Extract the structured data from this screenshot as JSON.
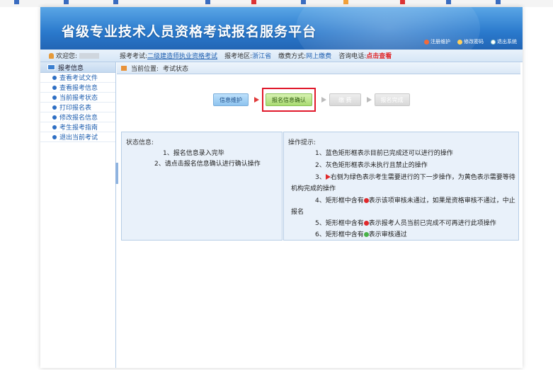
{
  "platform": {
    "title": "省级专业技术人员资格考试报名服务平台"
  },
  "toplinks": [
    {
      "label": "注册维护",
      "icon": "home-icon"
    },
    {
      "label": "修改密码",
      "icon": "lock-icon"
    },
    {
      "label": "退出系统",
      "icon": "power-icon"
    }
  ],
  "infobar": {
    "welcome": "欢迎您:",
    "exam_label": "报考考试:",
    "exam_value": "二级建造师执业资格考试",
    "region_label": "报考地区:",
    "region_value": "浙江省",
    "pay_label": "缴费方式:",
    "pay_value": "网上缴费",
    "phone_label": "咨询电话:",
    "phone_value": "点击查看"
  },
  "sidebar": {
    "header": "报考信息",
    "items": [
      {
        "label": "查看考试文件"
      },
      {
        "label": "查看报考信息"
      },
      {
        "label": "当前报考状态"
      },
      {
        "label": "打印报名表"
      },
      {
        "label": "修改报名信息"
      },
      {
        "label": "考生报考指南"
      },
      {
        "label": "退出当前考试"
      }
    ]
  },
  "breadcrumb": {
    "label": "当前位置:",
    "value": "考试状态"
  },
  "steps": [
    {
      "label": "信息维护",
      "state": "blue"
    },
    {
      "label": "报名信息确认",
      "state": "green"
    },
    {
      "label": "缴 费",
      "state": "gray"
    },
    {
      "label": "报名完成",
      "state": "gray"
    }
  ],
  "status_panel": {
    "title": "状态信息:",
    "lines": [
      "1、报名信息录入完毕",
      "2、请点击报名信息确认进行确认操作"
    ]
  },
  "hint_panel": {
    "title": "操作提示:",
    "line1": "1、蓝色矩形框表示目前已完成还可以进行的操作",
    "line2": "2、灰色矩形框表示未执行且禁止的操作",
    "line3_pre": "3、",
    "line3_post": "右侧为绿色表示考生需要进行的下一步操作，为黄色表示需要等待",
    "line3_cont": "机构完成的操作",
    "line4_pre": "4、矩形框中含有",
    "line4_post": "表示该项审核未通过，如果是资格审核不通过，中止",
    "line4_cont": "报名",
    "line5_pre": "5、矩形框中含有",
    "line5_post": "表示报考人员当前已完成不可再进行此项操作",
    "line6_pre": "6、矩形框中含有",
    "line6_post": "表示审核通过"
  },
  "colors": {
    "banner": "#2a79cc",
    "accent_red": "#e0292b",
    "link_blue": "#1f5fb0",
    "step_green": "#a9db72"
  }
}
